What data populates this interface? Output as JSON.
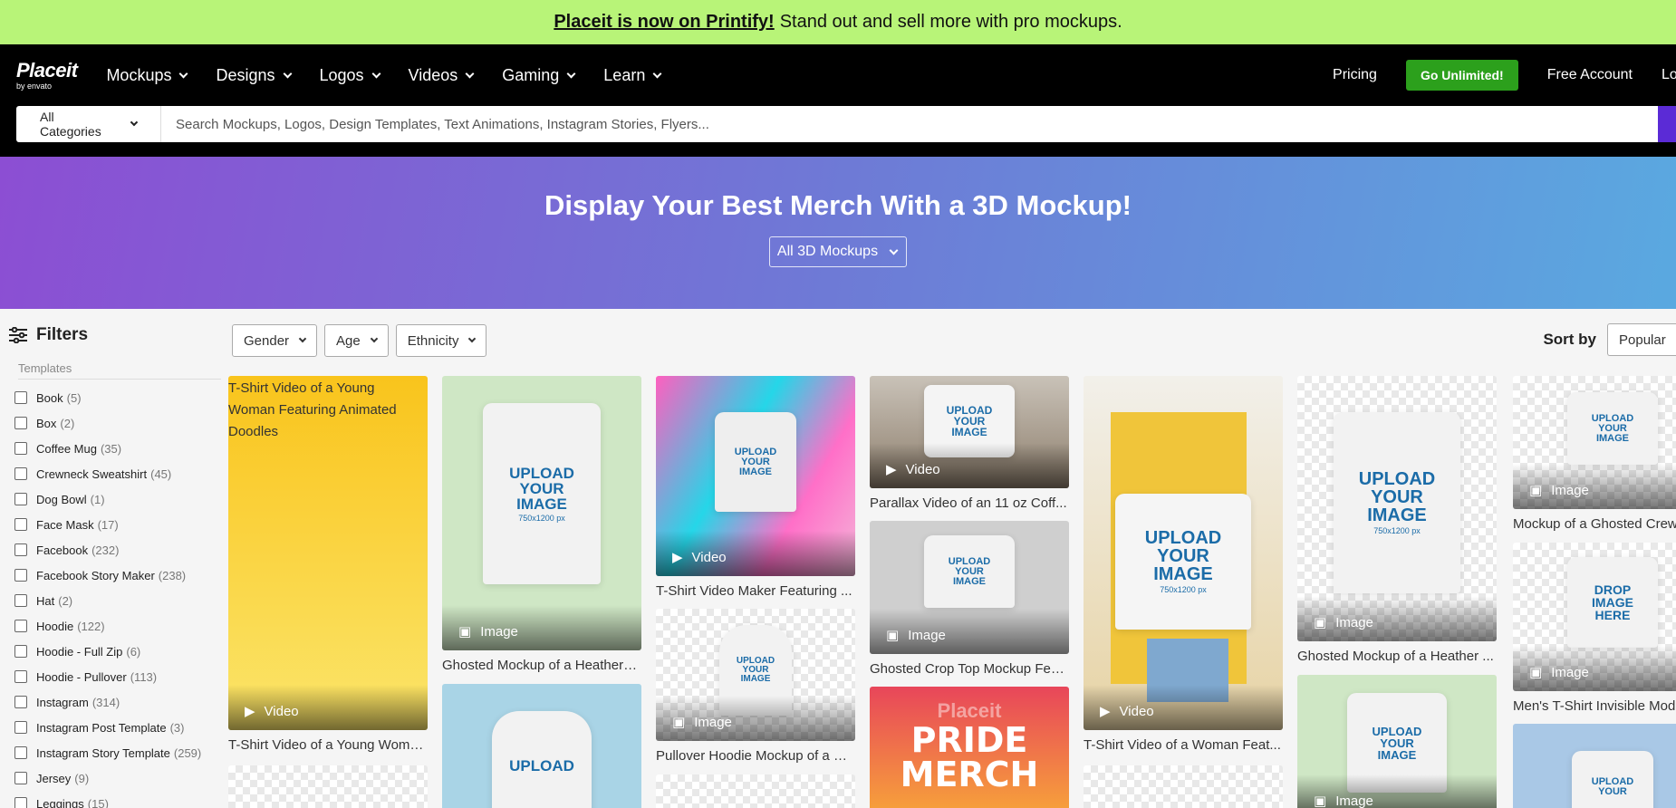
{
  "promo": {
    "bold": "Placeit is now on Printify!",
    "text": "Stand out and sell more with pro mockups."
  },
  "nav": {
    "logo": "Placeit",
    "logo_sub": "by envato",
    "items": [
      "Mockups",
      "Designs",
      "Logos",
      "Videos",
      "Gaming",
      "Learn"
    ],
    "pricing": "Pricing",
    "cta": "Go Unlimited!",
    "free_account": "Free Account",
    "login": "Lo"
  },
  "search": {
    "category": "All Categories",
    "placeholder": "Search Mockups, Logos, Design Templates, Text Animations, Instagram Stories, Flyers..."
  },
  "hero": {
    "title": "Display Your Best Merch With a 3D Mockup!",
    "select": "All 3D Mockups"
  },
  "filters": {
    "title": "Filters",
    "section": "Templates",
    "items": [
      {
        "label": "Book",
        "count": "(5)"
      },
      {
        "label": "Box",
        "count": "(2)"
      },
      {
        "label": "Coffee Mug",
        "count": "(35)"
      },
      {
        "label": "Crewneck Sweatshirt",
        "count": "(45)"
      },
      {
        "label": "Dog Bowl",
        "count": "(1)"
      },
      {
        "label": "Face Mask",
        "count": "(17)"
      },
      {
        "label": "Facebook",
        "count": "(232)"
      },
      {
        "label": "Facebook Story Maker",
        "count": "(238)"
      },
      {
        "label": "Hat",
        "count": "(2)"
      },
      {
        "label": "Hoodie",
        "count": "(122)"
      },
      {
        "label": "Hoodie - Full Zip",
        "count": "(6)"
      },
      {
        "label": "Hoodie - Pullover",
        "count": "(113)"
      },
      {
        "label": "Instagram",
        "count": "(314)"
      },
      {
        "label": "Instagram Post Template",
        "count": "(3)"
      },
      {
        "label": "Instagram Story Template",
        "count": "(259)"
      },
      {
        "label": "Jersey",
        "count": "(9)"
      },
      {
        "label": "Leggings",
        "count": "(15)"
      }
    ]
  },
  "toolbar": {
    "gender": "Gender",
    "age": "Age",
    "ethnicity": "Ethnicity",
    "sort_label": "Sort by",
    "sort_value": "Popular"
  },
  "badges": {
    "video": "Video",
    "image": "Image"
  },
  "cards": {
    "c1": {
      "alt": "T-Shirt Video of a Young Woman Featuring Animated Doodles",
      "caption": "T-Shirt Video of a Young Woma..."
    },
    "c2": {
      "caption": "Ghosted Mockup of a Heathere..."
    },
    "c3": {
      "caption": "T-Shirt Video Maker Featuring ..."
    },
    "c4": {
      "caption": "Pullover Hoodie Mockup of a G..."
    },
    "c5": {
      "caption": "Parallax Video of an 11 oz Coff..."
    },
    "c6": {
      "caption": "Ghosted Crop Top Mockup Fea..."
    },
    "c7": {
      "caption": "T-Shirt Video of a Woman Feat..."
    },
    "c8": {
      "caption": "Ghosted Mockup of a Heather ..."
    },
    "c9": {
      "caption": "Mockup of a Ghosted Crew"
    },
    "c10": {
      "caption": "Men's T-Shirt Invisible Mode"
    }
  },
  "art": {
    "upload_line1": "UPLOAD",
    "upload_line2": "YOUR",
    "upload_line3": "IMAGE",
    "upload_size": "750x1200 px",
    "drop_line1": "DROP",
    "drop_line2": "IMAGE",
    "drop_line3": "HERE",
    "pride_top": "Placeit",
    "pride_main": "PRIDE MERCH"
  },
  "colors": {
    "promo_bg": "#b8f478",
    "cta": "#2ca01c",
    "search_btn": "#5b2bd6"
  }
}
